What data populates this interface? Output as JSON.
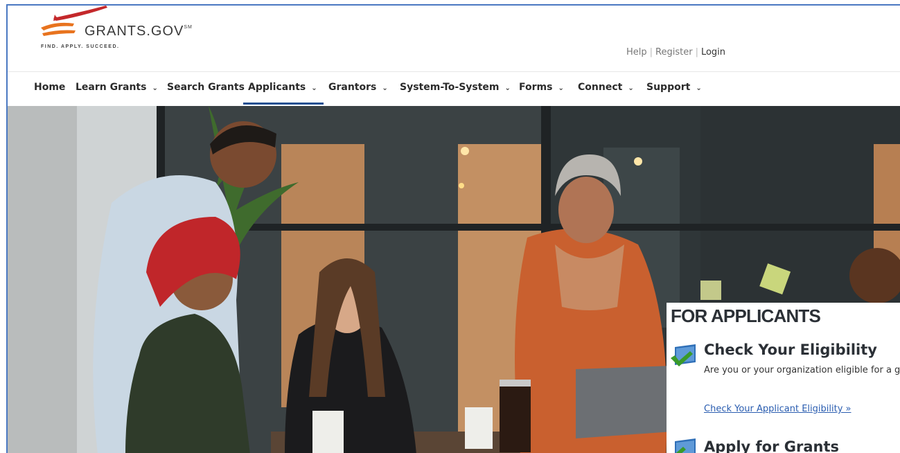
{
  "header": {
    "logo_text": "GRANTS.GOV",
    "logo_mark": "SM",
    "tagline": "FIND. APPLY. SUCCEED.",
    "util_links": {
      "help": "Help",
      "register": "Register",
      "login": "Login"
    }
  },
  "nav": {
    "items": [
      {
        "label": "Home",
        "dropdown": false
      },
      {
        "label": "Learn Grants",
        "dropdown": true
      },
      {
        "label": "Search Grants",
        "dropdown": false
      },
      {
        "label": "Applicants",
        "dropdown": true,
        "active": true
      },
      {
        "label": "Grantors",
        "dropdown": true
      },
      {
        "label": "System-To-System",
        "dropdown": true
      },
      {
        "label": "Forms",
        "dropdown": true
      },
      {
        "label": "Connect",
        "dropdown": true
      },
      {
        "label": "Support",
        "dropdown": true
      }
    ],
    "chevron": "⌄"
  },
  "card": {
    "title": "FOR APPLICANTS",
    "sections": [
      {
        "icon": "checkmark-monitor-icon",
        "heading": "Check Your Eligibility",
        "description": "Are you or your organization eligible for a gra",
        "link": "Check Your Applicant Eligibility »"
      },
      {
        "icon": "apply-monitor-icon",
        "heading": "Apply for Grants"
      }
    ]
  },
  "colors": {
    "accent": "#1d4f91",
    "link": "#2a5db0",
    "logo_orange": "#e8731e",
    "logo_red": "#c4282b"
  }
}
